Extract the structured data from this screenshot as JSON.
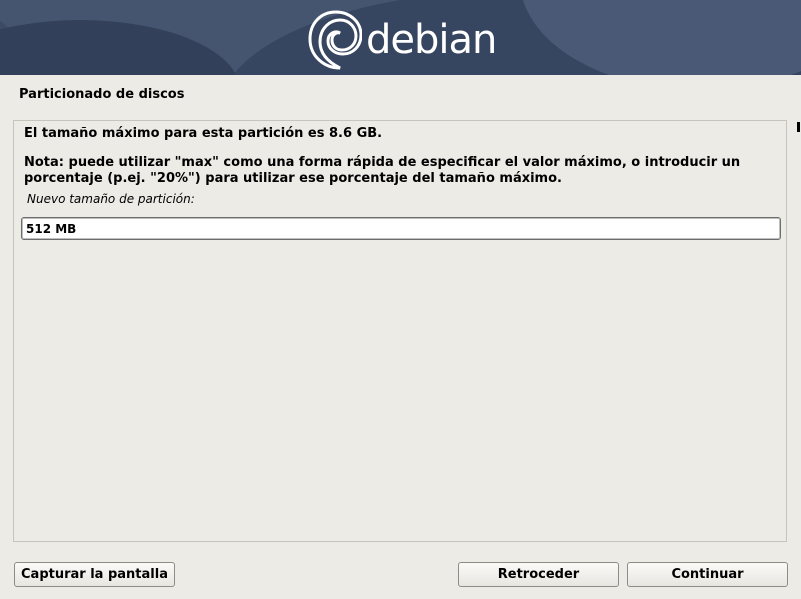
{
  "banner": {
    "logo_text": "debian",
    "colors": {
      "background": "#3c4a63",
      "text": "#ffffff"
    }
  },
  "page": {
    "title": "Particionado de discos"
  },
  "content": {
    "line1": "El tamaño máximo para esta partición es 8.6 GB.",
    "note": "Nota: puede utilizar \"max\" como una forma rápida de especificar el valor máximo, o introducir un porcentaje (p.ej. \"20%\") para utilizar ese porcentaje del tamaño máximo.",
    "field_label": "Nuevo tamaño de partición:",
    "field_value": "512 MB"
  },
  "buttons": {
    "capture": "Capturar la pantalla",
    "back": "Retroceder",
    "continue": "Continuar"
  }
}
